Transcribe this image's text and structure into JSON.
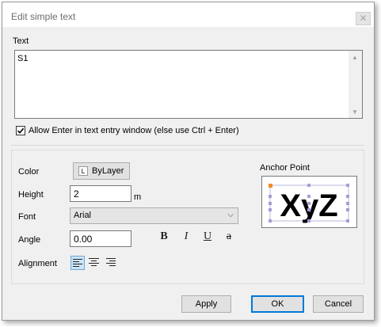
{
  "window": {
    "title": "Edit simple text",
    "close_glyph": "✕"
  },
  "text_section": {
    "label": "Text",
    "value": "S1"
  },
  "allow_enter": {
    "label": "Allow Enter in text entry window (else use Ctrl + Enter)",
    "checked": true,
    "check_glyph": "✓"
  },
  "color": {
    "label": "Color",
    "button_icon_letter": "L",
    "button_label": "ByLayer"
  },
  "height": {
    "label": "Height",
    "value": "2",
    "unit": "m"
  },
  "font": {
    "label": "Font",
    "value": "Arial",
    "chevron": "⌵"
  },
  "angle": {
    "label": "Angle",
    "value": "0.00"
  },
  "format": {
    "bold": "B",
    "italic": "I",
    "underline": "U",
    "strike": "a"
  },
  "alignment": {
    "label": "Alignment",
    "selected": "left"
  },
  "anchor": {
    "label": "Anchor Point",
    "preview_text": "XyZ",
    "accent_color": "#f08c2a"
  },
  "buttons": {
    "apply": "Apply",
    "ok": "OK",
    "cancel": "Cancel"
  }
}
